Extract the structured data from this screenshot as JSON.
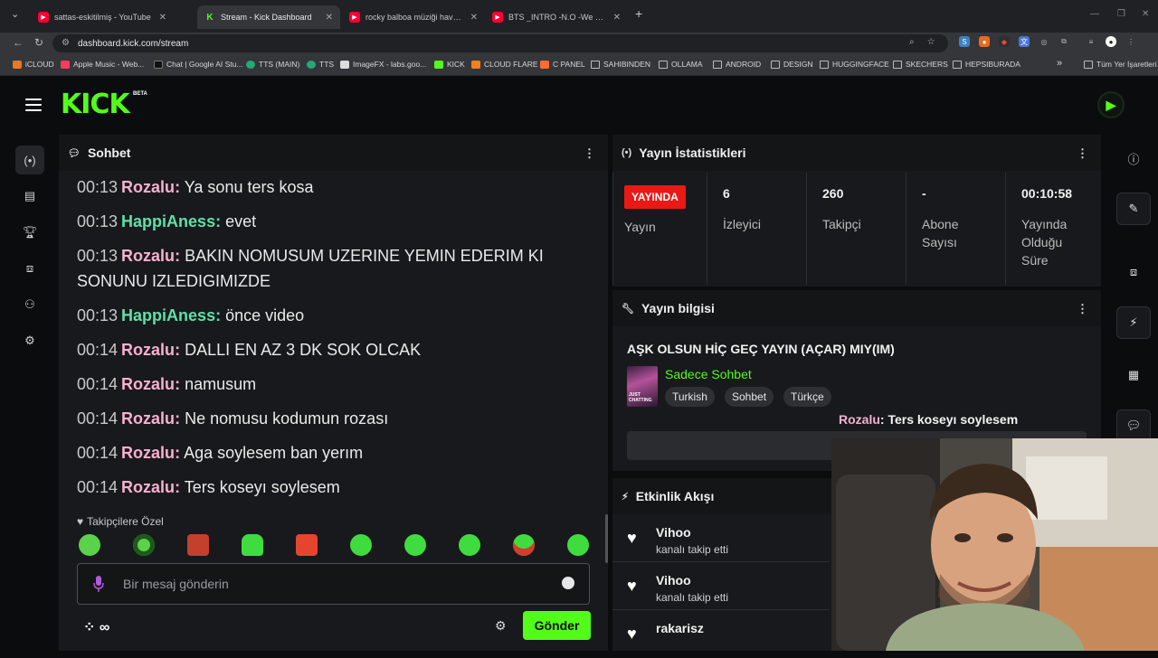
{
  "browser": {
    "tabs": [
      {
        "title": "sattas-eskitilmiş - YouTube",
        "type": "yt"
      },
      {
        "title": "Stream - Kick Dashboard",
        "type": "kick",
        "active": true
      },
      {
        "title": "rocky balboa müziği havalı döv",
        "type": "yt"
      },
      {
        "title": "BTS _INTRO -N.O -We are bulle",
        "type": "yt"
      }
    ],
    "url": "dashboard.kick.com/stream",
    "bookmarks": [
      "iCLOUD",
      "Apple Music - Web...",
      "Chat | Google AI Stu...",
      "TTS (MAIN)",
      "TTS",
      "ImageFX - labs.goo...",
      "KICK",
      "CLOUD FLARE",
      "C PANEL",
      "SAHIBINDEN",
      "OLLAMA",
      "ANDROID",
      "DESIGN",
      "HUGGINGFACE",
      "SKECHERS",
      "HEPSIBURADA"
    ],
    "bookmarks_overflow": "»",
    "all_bookmarks": "Tüm Yer İşaretleri"
  },
  "kick": {
    "logo": "KICK",
    "beta": "BETA",
    "accent": "#53fc18"
  },
  "chat": {
    "title": "Sohbet",
    "messages": [
      {
        "time": "00:13",
        "user": "Rozalu",
        "color": "pink",
        "text": "Ya sonu ters kosa"
      },
      {
        "time": "00:13",
        "user": "HappiAness",
        "color": "green",
        "text": "evet"
      },
      {
        "time": "00:13",
        "user": "Rozalu",
        "color": "pink",
        "text": "BAKIN NOMUSUM UZERINE YEMIN EDERIM KI SONUNU IZLEDIGIMIZDE"
      },
      {
        "time": "00:13",
        "user": "HappiAness",
        "color": "green",
        "text": "önce video"
      },
      {
        "time": "00:14",
        "user": "Rozalu",
        "color": "pink",
        "text": "DALLI EN AZ 3 DK SOK OLCAK"
      },
      {
        "time": "00:14",
        "user": "Rozalu",
        "color": "pink",
        "text": "namusum"
      },
      {
        "time": "00:14",
        "user": "Rozalu",
        "color": "pink",
        "text": "Ne nomusu kodumun rozası"
      },
      {
        "time": "00:14",
        "user": "Rozalu",
        "color": "pink",
        "text": "Aga soylesem ban yerım"
      },
      {
        "time": "00:14",
        "user": "Rozalu",
        "color": "pink",
        "text": "Ters koseyı soylesem"
      }
    ],
    "follower_only": "Takipçilere Özel",
    "placeholder": "Bir mesaj gönderin",
    "send_label": "Gönder",
    "bottom_symbol": "∞"
  },
  "stats": {
    "title": "Yayın İstatistikleri",
    "live_badge": "YAYINDA",
    "live_label": "Yayın",
    "items": [
      {
        "value": "6",
        "label": "İzleyici"
      },
      {
        "value": "260",
        "label": "Takipçi"
      },
      {
        "value": "-",
        "label": "Abone Sayısı"
      },
      {
        "value": "00:10:58",
        "label": "Yayında Olduğu Süre"
      }
    ]
  },
  "info": {
    "title": "Yayın bilgisi",
    "stream_title": "AŞK OLSUN HİÇ GEÇ YAYIN (AÇAR) MIY(IM)",
    "category": "Sadece Sohbet",
    "category_thumb_text": "JUST CHATTING",
    "tags": [
      "Turkish",
      "Sohbet",
      "Türkçe"
    ],
    "overlay_user": "Rozalu",
    "overlay_text": ": Ters koseyı soylesem"
  },
  "activity": {
    "title": "Etkinlik Akışı",
    "events": [
      {
        "name": "Vihoo",
        "desc": "kanalı takip etti"
      },
      {
        "name": "Vihoo",
        "desc": "kanalı takip etti"
      },
      {
        "name": "rakarisz",
        "desc": ""
      }
    ]
  }
}
